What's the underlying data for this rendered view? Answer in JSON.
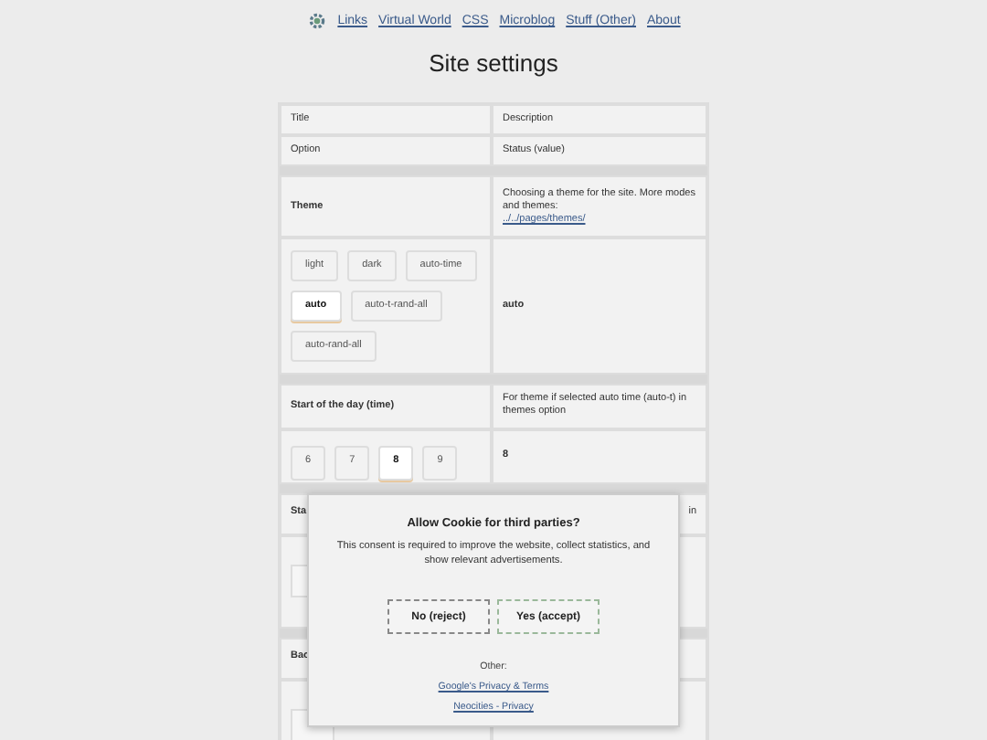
{
  "nav": {
    "links": [
      "Links",
      "Virtual World",
      "CSS",
      "Microblog",
      "Stuff (Other)",
      "About"
    ]
  },
  "page": {
    "title": "Site settings"
  },
  "table": {
    "header_rows": [
      [
        "Title",
        "Description"
      ],
      [
        "Option",
        "Status (value)"
      ]
    ],
    "sections": [
      {
        "title": "Theme",
        "description": "Choosing a theme for the site. More modes and themes:",
        "link": "../../pages/themes/",
        "options": [
          {
            "label": "light",
            "selected": false
          },
          {
            "label": "dark",
            "selected": false
          },
          {
            "label": "auto-time",
            "selected": false
          },
          {
            "label": "auto",
            "selected": true
          },
          {
            "label": "auto-t-rand-all",
            "selected": false
          },
          {
            "label": "auto-rand-all",
            "selected": false
          }
        ],
        "value": "auto"
      },
      {
        "title": "Start of the day (time)",
        "description": "For theme if selected auto time (auto-t) in themes option",
        "options": [
          {
            "label": "6",
            "selected": false
          },
          {
            "label": "7",
            "selected": false
          },
          {
            "label": "8",
            "selected": true
          },
          {
            "label": "9",
            "selected": false
          }
        ],
        "value": "8"
      },
      {
        "title": "Sta",
        "description": "in"
      },
      {
        "title": "Bac"
      }
    ]
  },
  "cookie_dialog": {
    "title": "Allow Cookie for third parties?",
    "message": "This consent is required to improve the website, collect statistics, and show relevant advertisements.",
    "buttons": [
      {
        "label": "No (reject)",
        "kind": "reject"
      },
      {
        "label": "Yes (accept)",
        "kind": "accept"
      }
    ],
    "other_label": "Other:",
    "links": [
      "Google's Privacy & Terms",
      "Neocities - Privacy"
    ]
  }
}
